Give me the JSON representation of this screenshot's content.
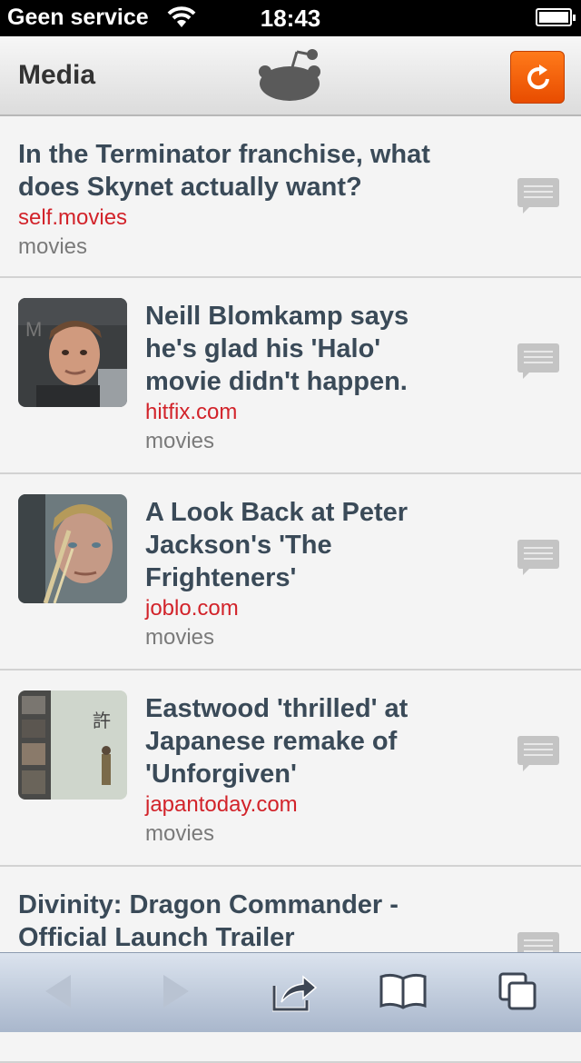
{
  "status_bar": {
    "carrier": "Geen service",
    "time": "18:43"
  },
  "header": {
    "title": "Media",
    "logo_icon": "reddit-alien-icon",
    "refresh_icon": "refresh-icon"
  },
  "posts": [
    {
      "title_lines": [
        "In the Terminator franchise, what",
        "does Skynet actually want?"
      ],
      "domain": "self.movies",
      "subreddit": "movies",
      "has_thumbnail": false
    },
    {
      "title_lines": [
        "Neill Blomkamp says",
        "he's glad his 'Halo'",
        "movie didn't happen."
      ],
      "domain": "hitfix.com",
      "subreddit": "movies",
      "has_thumbnail": true
    },
    {
      "title_lines": [
        "A Look Back at Peter",
        "Jackson's 'The",
        "Frighteners'"
      ],
      "domain": "joblo.com",
      "subreddit": "movies",
      "has_thumbnail": true
    },
    {
      "title_lines": [
        "Eastwood 'thrilled' at",
        "Japanese remake of",
        "'Unforgiven'"
      ],
      "domain": "japantoday.com",
      "subreddit": "movies",
      "has_thumbnail": true
    },
    {
      "title_lines": [
        "Divinity: Dragon Commander -",
        "Official Launch Trailer"
      ],
      "domain": "",
      "subreddit": "",
      "has_thumbnail": false
    }
  ],
  "toolbar": {
    "back_icon": "back-arrow-icon",
    "forward_icon": "forward-arrow-icon",
    "share_icon": "share-icon",
    "bookmarks_icon": "bookmarks-icon",
    "tabs_icon": "tabs-icon"
  },
  "colors": {
    "accent": "#ee5a0a",
    "title_text": "#3a4a58",
    "domain_text": "#d2232a"
  }
}
